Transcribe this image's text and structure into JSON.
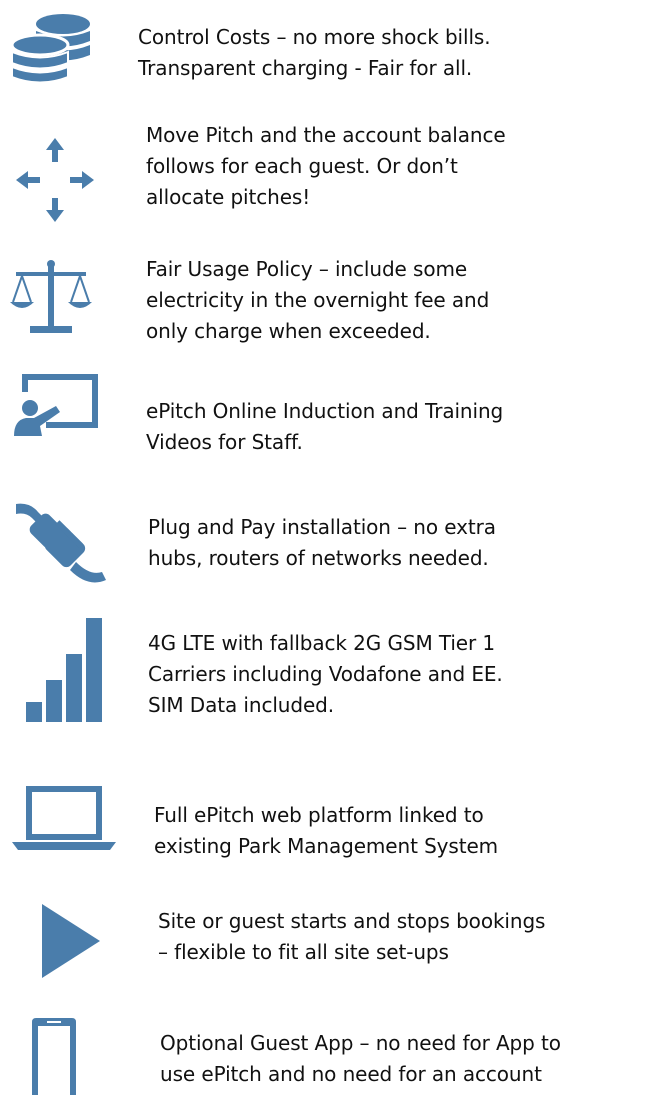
{
  "accent_color": "#4a7dab",
  "features": [
    {
      "icon": "coins-icon",
      "lines": [
        "Control Costs – no more shock bills.",
        "Transparent charging - Fair for all."
      ]
    },
    {
      "icon": "move-arrows-icon",
      "lines": [
        "Move Pitch and the account balance",
        "follows for each guest. Or don’t",
        "allocate pitches!"
      ]
    },
    {
      "icon": "scales-icon",
      "lines": [
        "Fair Usage Policy – include some",
        "electricity in the overnight fee and",
        "only charge when exceeded."
      ]
    },
    {
      "icon": "presentation-icon",
      "lines": [
        "ePitch Online Induction and Training",
        "Videos for Staff."
      ]
    },
    {
      "icon": "plug-icon",
      "lines": [
        "Plug and Pay installation – no extra",
        "hubs, routers of networks needed."
      ]
    },
    {
      "icon": "signal-bars-icon",
      "lines": [
        "4G LTE with fallback 2G GSM Tier 1",
        "Carriers including Vodafone and EE.",
        "SIM Data included."
      ]
    },
    {
      "icon": "laptop-icon",
      "lines": [
        "Full ePitch web platform linked to",
        "existing Park Management System"
      ]
    },
    {
      "icon": "play-icon",
      "lines": [
        "Site or guest starts and stops bookings",
        "– flexible to fit all site set-ups"
      ]
    },
    {
      "icon": "mobile-phone-icon",
      "lines": [
        "Optional Guest App – no need for App to",
        "use ePitch and no need for an account"
      ]
    }
  ]
}
